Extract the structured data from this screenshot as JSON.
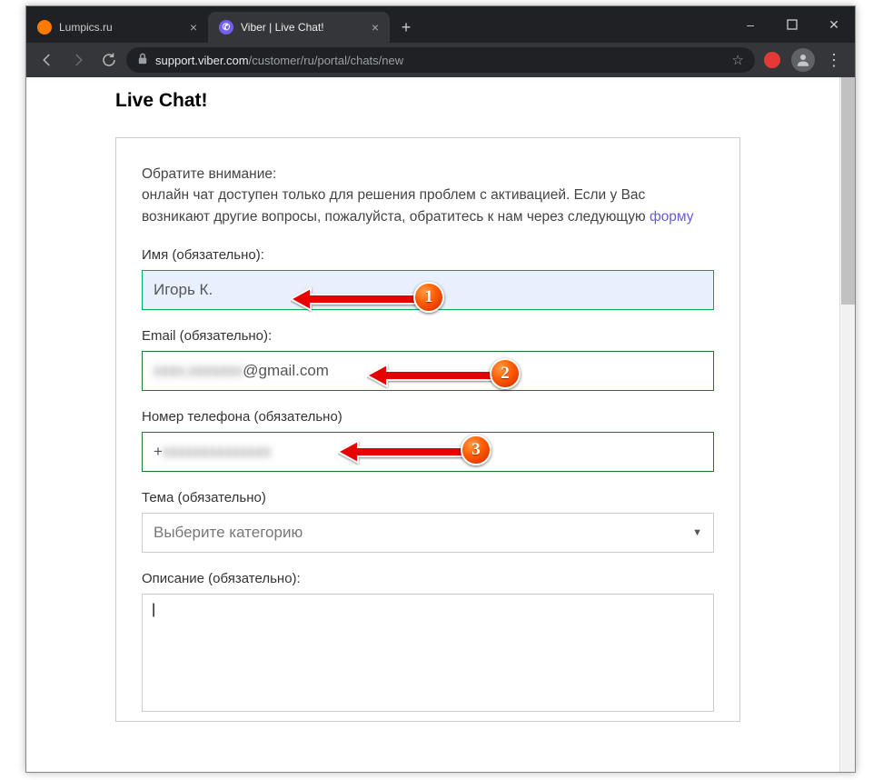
{
  "window": {
    "tabs": [
      {
        "title": "Lumpics.ru",
        "active": false
      },
      {
        "title": "Viber | Live Chat!",
        "active": true
      }
    ],
    "controls": {
      "minimize": "–",
      "maximize": "▢",
      "close": "✕"
    },
    "newtab": "+"
  },
  "addressbar": {
    "host": "support.viber.com",
    "path": "/customer/ru/portal/chats/new"
  },
  "page": {
    "title": "Live Chat!",
    "notice_line1": "Обратите внимание:",
    "notice_line2a": "онлайн чат доступен только для решения проблем с активацией. Если у Вас возникают другие вопросы, пожалуйста, обратитесь к нам через следующую ",
    "notice_link": "форму",
    "fields": {
      "name": {
        "label": "Имя (обязательно):",
        "value": "Игорь К."
      },
      "email": {
        "label": "Email (обязательно):",
        "value_hidden": "xxxx.xxxxxxx",
        "value_visible": "@gmail.com"
      },
      "phone": {
        "label": "Номер телефона (обязательно)",
        "value_prefix": "+",
        "value_hidden": "xxxxxxxxxxxxxx"
      },
      "topic": {
        "label": "Тема (обязательно)",
        "placeholder": "Выберите категорию"
      },
      "description": {
        "label": "Описание (обязательно):",
        "value": "|"
      }
    }
  },
  "annotations": {
    "badge1": "1",
    "badge2": "2",
    "badge3": "3"
  }
}
